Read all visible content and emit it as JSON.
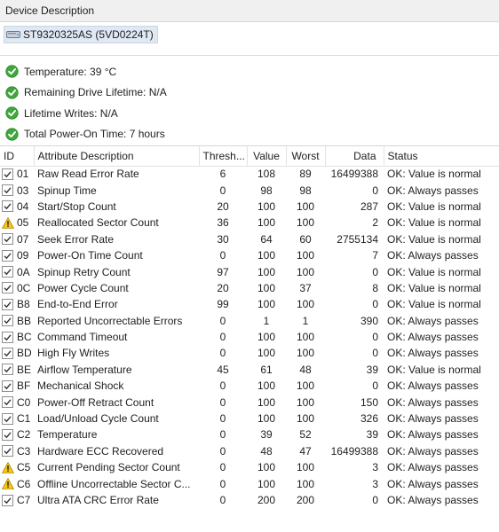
{
  "header": {
    "title": "Device Description"
  },
  "device": {
    "name": "ST9320325AS (5VD0224T)",
    "icon": "drive-icon"
  },
  "summary": [
    {
      "icon": "ok-check-icon",
      "text": "Temperature: 39 °C"
    },
    {
      "icon": "ok-check-icon",
      "text": "Remaining Drive Lifetime: N/A"
    },
    {
      "icon": "ok-check-icon",
      "text": "Lifetime Writes: N/A"
    },
    {
      "icon": "ok-check-icon",
      "text": "Total Power-On Time: 7 hours"
    }
  ],
  "table": {
    "headers": {
      "id": "ID",
      "attr": "Attribute Description",
      "thresh": "Thresh...",
      "value": "Value",
      "worst": "Worst",
      "data": "Data",
      "status": "Status"
    },
    "rows": [
      {
        "id": "01",
        "attr": "Raw Read Error Rate",
        "thresh": "6",
        "value": "108",
        "worst": "89",
        "data": "16499388",
        "status": "OK: Value is normal",
        "icon": "checkbox"
      },
      {
        "id": "03",
        "attr": "Spinup Time",
        "thresh": "0",
        "value": "98",
        "worst": "98",
        "data": "0",
        "status": "OK: Always passes",
        "icon": "checkbox"
      },
      {
        "id": "04",
        "attr": "Start/Stop Count",
        "thresh": "20",
        "value": "100",
        "worst": "100",
        "data": "287",
        "status": "OK: Value is normal",
        "icon": "checkbox"
      },
      {
        "id": "05",
        "attr": "Reallocated Sector Count",
        "thresh": "36",
        "value": "100",
        "worst": "100",
        "data": "2",
        "status": "OK: Value is normal",
        "icon": "warning"
      },
      {
        "id": "07",
        "attr": "Seek Error Rate",
        "thresh": "30",
        "value": "64",
        "worst": "60",
        "data": "2755134",
        "status": "OK: Value is normal",
        "icon": "checkbox"
      },
      {
        "id": "09",
        "attr": "Power-On Time Count",
        "thresh": "0",
        "value": "100",
        "worst": "100",
        "data": "7",
        "status": "OK: Always passes",
        "icon": "checkbox"
      },
      {
        "id": "0A",
        "attr": "Spinup Retry Count",
        "thresh": "97",
        "value": "100",
        "worst": "100",
        "data": "0",
        "status": "OK: Value is normal",
        "icon": "checkbox"
      },
      {
        "id": "0C",
        "attr": "Power Cycle Count",
        "thresh": "20",
        "value": "100",
        "worst": "37",
        "data": "8",
        "status": "OK: Value is normal",
        "icon": "checkbox"
      },
      {
        "id": "B8",
        "attr": "End-to-End Error",
        "thresh": "99",
        "value": "100",
        "worst": "100",
        "data": "0",
        "status": "OK: Value is normal",
        "icon": "checkbox"
      },
      {
        "id": "BB",
        "attr": "Reported Uncorrectable Errors",
        "thresh": "0",
        "value": "1",
        "worst": "1",
        "data": "390",
        "status": "OK: Always passes",
        "icon": "checkbox"
      },
      {
        "id": "BC",
        "attr": "Command Timeout",
        "thresh": "0",
        "value": "100",
        "worst": "100",
        "data": "0",
        "status": "OK: Always passes",
        "icon": "checkbox"
      },
      {
        "id": "BD",
        "attr": "High Fly Writes",
        "thresh": "0",
        "value": "100",
        "worst": "100",
        "data": "0",
        "status": "OK: Always passes",
        "icon": "checkbox"
      },
      {
        "id": "BE",
        "attr": "Airflow Temperature",
        "thresh": "45",
        "value": "61",
        "worst": "48",
        "data": "39",
        "status": "OK: Value is normal",
        "icon": "checkbox"
      },
      {
        "id": "BF",
        "attr": "Mechanical Shock",
        "thresh": "0",
        "value": "100",
        "worst": "100",
        "data": "0",
        "status": "OK: Always passes",
        "icon": "checkbox"
      },
      {
        "id": "C0",
        "attr": "Power-Off Retract Count",
        "thresh": "0",
        "value": "100",
        "worst": "100",
        "data": "150",
        "status": "OK: Always passes",
        "icon": "checkbox"
      },
      {
        "id": "C1",
        "attr": "Load/Unload Cycle Count",
        "thresh": "0",
        "value": "100",
        "worst": "100",
        "data": "326",
        "status": "OK: Always passes",
        "icon": "checkbox"
      },
      {
        "id": "C2",
        "attr": "Temperature",
        "thresh": "0",
        "value": "39",
        "worst": "52",
        "data": "39",
        "status": "OK: Always passes",
        "icon": "checkbox"
      },
      {
        "id": "C3",
        "attr": "Hardware ECC Recovered",
        "thresh": "0",
        "value": "48",
        "worst": "47",
        "data": "16499388",
        "status": "OK: Always passes",
        "icon": "checkbox"
      },
      {
        "id": "C5",
        "attr": "Current Pending Sector Count",
        "thresh": "0",
        "value": "100",
        "worst": "100",
        "data": "3",
        "status": "OK: Always passes",
        "icon": "warning"
      },
      {
        "id": "C6",
        "attr": "Offline Uncorrectable Sector C...",
        "thresh": "0",
        "value": "100",
        "worst": "100",
        "data": "3",
        "status": "OK: Always passes",
        "icon": "warning"
      },
      {
        "id": "C7",
        "attr": "Ultra ATA CRC Error Rate",
        "thresh": "0",
        "value": "200",
        "worst": "200",
        "data": "0",
        "status": "OK: Always passes",
        "icon": "checkbox"
      }
    ]
  },
  "colors": {
    "ok_green": "#3fa83a",
    "warning_yellow": "#f2c511",
    "chip_bg": "#dfe8f3"
  }
}
